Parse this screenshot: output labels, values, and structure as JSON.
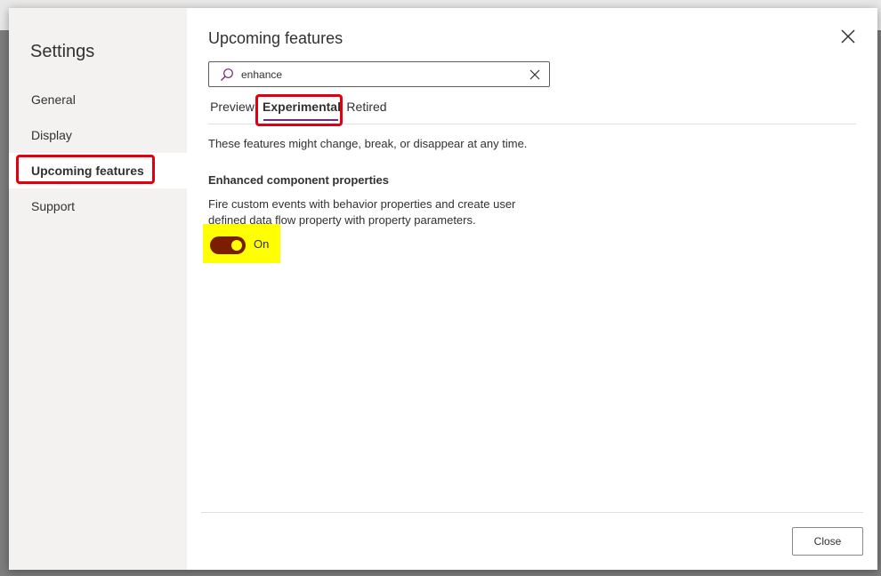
{
  "sidebar": {
    "title": "Settings",
    "items": [
      {
        "label": "General"
      },
      {
        "label": "Display"
      },
      {
        "label": "Upcoming features"
      },
      {
        "label": "Support"
      }
    ]
  },
  "main": {
    "title": "Upcoming features",
    "search": {
      "value": "enhance",
      "placeholder": ""
    },
    "tabs": [
      {
        "label": "Preview"
      },
      {
        "label": "Experimental"
      },
      {
        "label": "Retired"
      }
    ],
    "description": "These features might change, break, or disappear at any time.",
    "feature": {
      "title": "Enhanced component properties",
      "description": "Fire custom events with behavior properties and create user defined data flow property with property parameters.",
      "toggle_label": "On",
      "enabled": true
    }
  },
  "footer": {
    "close_label": "Close"
  },
  "colors": {
    "accent": "#742774",
    "highlight_border": "#e0000f",
    "highlight_fill": "#ffff00",
    "toggle_on": "#7a1d00"
  },
  "icons": {
    "close": "close-icon",
    "search": "search-icon",
    "clear": "clear-icon"
  }
}
